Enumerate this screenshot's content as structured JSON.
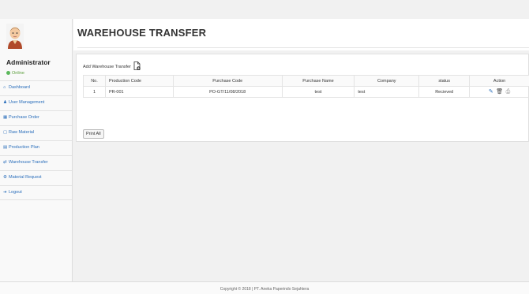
{
  "sidebar": {
    "user_name": "Administrator",
    "status": "Online",
    "items": [
      {
        "label": "Dashboard",
        "icon": "home-icon",
        "glyph": "⌂"
      },
      {
        "label": "User Management",
        "icon": "user-icon",
        "glyph": "♟"
      },
      {
        "label": "Purchase Order",
        "icon": "table-icon",
        "glyph": "▦"
      },
      {
        "label": "Raw Material",
        "icon": "box-icon",
        "glyph": "▢"
      },
      {
        "label": "Production Plan",
        "icon": "calendar-icon",
        "glyph": "▤"
      },
      {
        "label": "Warehouse Transfer",
        "icon": "transfer-icon",
        "glyph": "⇄"
      },
      {
        "label": "Material Request",
        "icon": "settings-icon",
        "glyph": "⚙"
      },
      {
        "label": "Logout",
        "icon": "logout-icon",
        "glyph": "➔"
      }
    ]
  },
  "page": {
    "title": "WAREHOUSE TRANSFER",
    "add_label": "Add Warehouse Transfer",
    "print_all": "Print All"
  },
  "table": {
    "headers": [
      "No.",
      "Production Code",
      "Purchase Code",
      "Purchase Name",
      "Company",
      "status",
      "Action"
    ],
    "rows": [
      {
        "no": "1",
        "production_code": "PR-001",
        "purchase_code": "PO-GT/11/08/2018",
        "purchase_name": "test",
        "company": "test",
        "status": "Recieved"
      }
    ]
  },
  "footer": {
    "text": "Copyright © 2018 | PT. Aneka Paperindo Sejahtera"
  },
  "colors": {
    "link": "#2a6ebb",
    "online": "#5cb85c"
  }
}
